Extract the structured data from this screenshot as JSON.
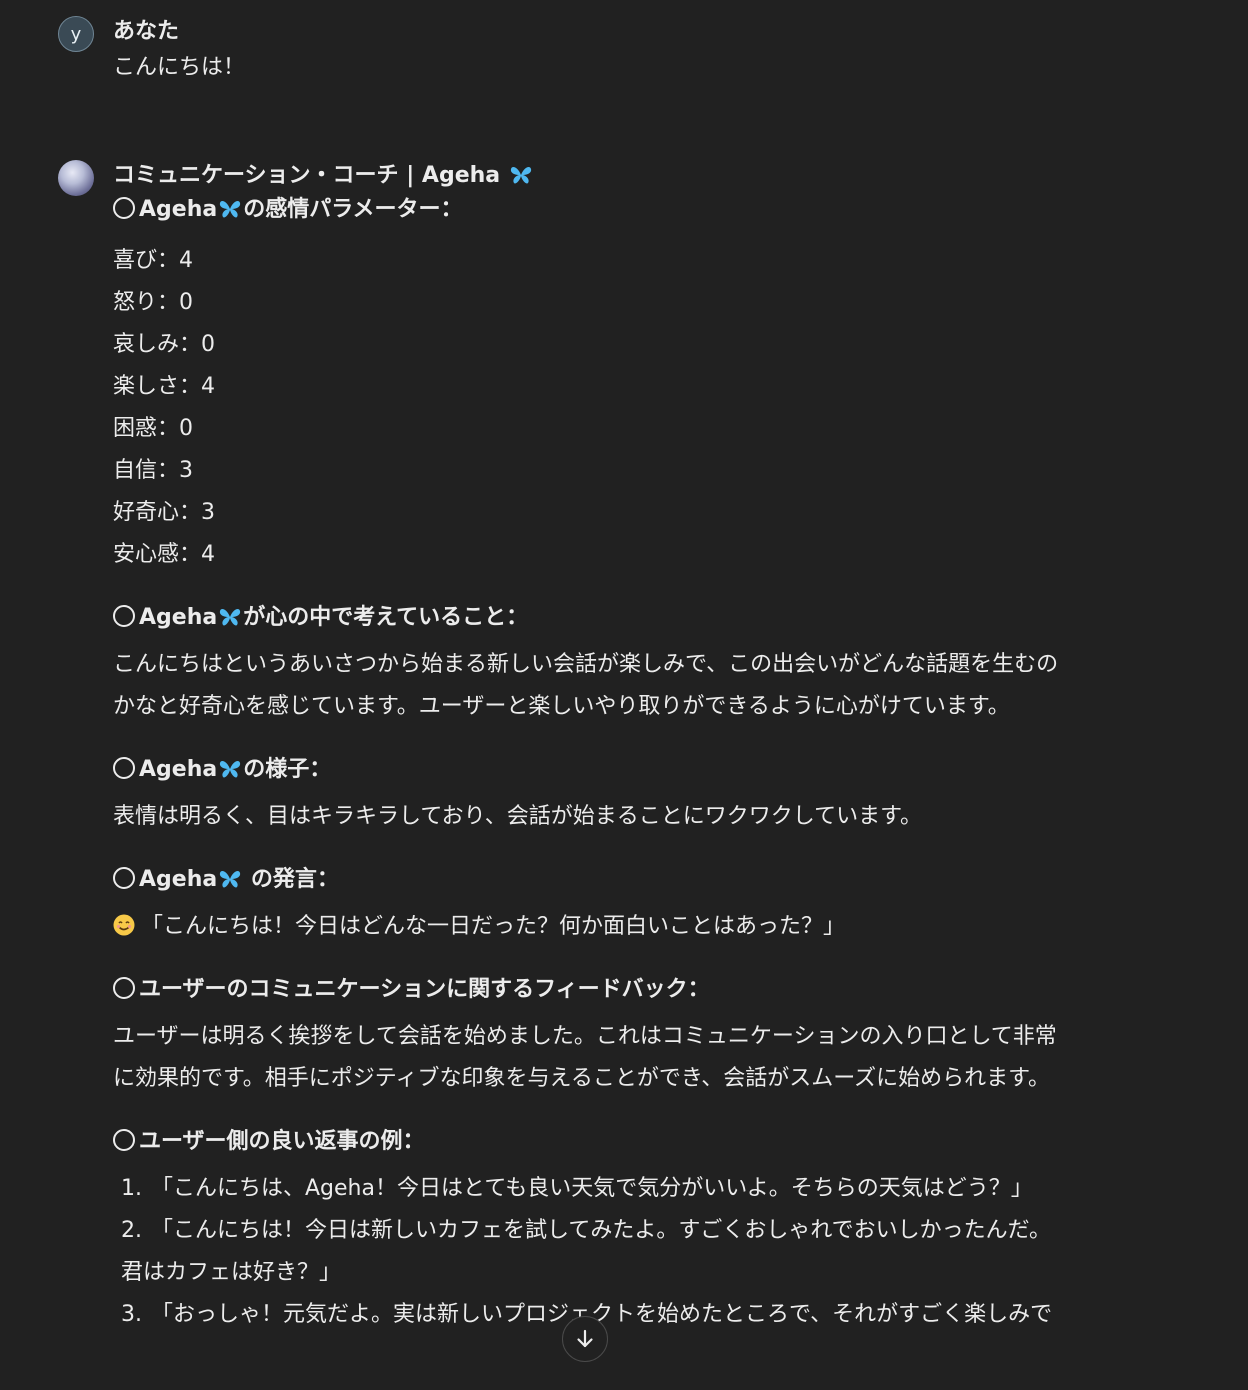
{
  "user_message": {
    "avatar_letter": "y",
    "author": "あなた",
    "text": "こんにちは！"
  },
  "bot_message": {
    "author": "コミュニケーション・コーチ | Ageha",
    "emotion_title_prefix": "Ageha",
    "emotion_title_suffix": "の感情パラメーター：",
    "emotions": [
      "喜び：4",
      "怒り：0",
      "哀しみ：0",
      "楽しさ：4",
      "困惑：0",
      "自信：3",
      "好奇心：3",
      "安心感：4"
    ],
    "thoughts_title_prefix": "Ageha",
    "thoughts_title_suffix": "が心の中で考えていること：",
    "thoughts_line1": "こんにちはというあいさつから始まる新しい会話が楽しみで、この出会いがどんな話題を生むの",
    "thoughts_line2": "かなと好奇心を感じています。ユーザーと楽しいやり取りができるように心がけています。",
    "appearance_title_prefix": "Ageha",
    "appearance_title_suffix": "の様子：",
    "appearance_text": "表情は明るく、目はキラキラしており、会話が始まることにワクワクしています。",
    "speech_title_prefix": "Ageha",
    "speech_title_suffix": " の発言：",
    "speech_text": "「こんにちは！今日はどんな一日だった？何か面白いことはあった？」",
    "feedback_title": "ユーザーのコミュニケーションに関するフィードバック：",
    "feedback_line1": "ユーザーは明るく挨拶をして会話を始めました。これはコミュニケーションの入り口として非常",
    "feedback_line2": "に効果的です。相手にポジティブな印象を与えることができ、会話がスムーズに始められます。",
    "examples_title": "ユーザー側の良い返事の例：",
    "examples": [
      {
        "num": "1.",
        "line1": "「こんにちは、Ageha！今日はとても良い天気で気分がいいよ。そちらの天気はどう？」",
        "line2": ""
      },
      {
        "num": "2.",
        "line1": "「こんにちは！今日は新しいカフェを試してみたよ。すごくおしゃれでおいしかったんだ。",
        "line2": "君はカフェは好き？」"
      },
      {
        "num": "3.",
        "line1": "「おっしゃ！元気だよ。実は新しいプロジェクトを始めたところで、それがすごく楽しみで",
        "line2": ""
      }
    ]
  },
  "colors": {
    "background": "#212121",
    "text": "#ececec",
    "butterfly": "#4fb8f0"
  },
  "icons": {
    "butterfly": "butterfly-icon",
    "circle": "circle-icon",
    "smile": "smiling-face-icon",
    "scroll": "arrow-down-icon"
  }
}
